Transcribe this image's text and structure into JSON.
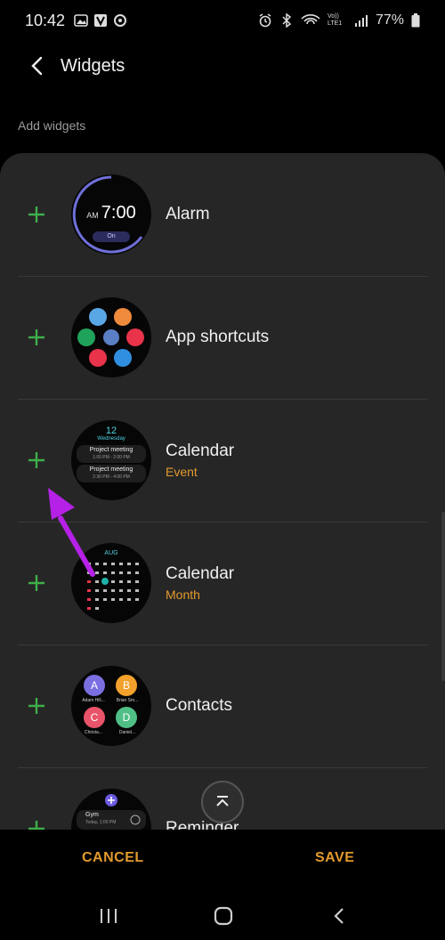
{
  "status_bar": {
    "time": "10:42",
    "battery": "77%",
    "net": "Vo)) LTE1"
  },
  "header": {
    "title": "Widgets"
  },
  "section": {
    "label": "Add widgets"
  },
  "widgets": [
    {
      "title": "Alarm",
      "sub": "",
      "ampm": "AM",
      "clock": "7:00",
      "state": "On"
    },
    {
      "title": "App shortcuts",
      "sub": ""
    },
    {
      "title": "Calendar",
      "sub": "Event",
      "day": "12",
      "weekday": "Wednesday",
      "event1": "Project meeting",
      "time1": "1:00 PM - 2:00 PM",
      "event2": "Project meeting",
      "time2": "2:30 PM - 4:00 PM"
    },
    {
      "title": "Calendar",
      "sub": "Month",
      "month": "AUG"
    },
    {
      "title": "Contacts",
      "sub": "",
      "c1": "A",
      "n1": "Adam Hill...",
      "c2": "B",
      "n2": "Brian Sm...",
      "c3": "C",
      "n3": "Christa...",
      "c4": "D",
      "n4": "Daniel..."
    },
    {
      "title": "Reminder",
      "sub": "",
      "item": "Gym",
      "item_time": "Today, 1:00 PM"
    }
  ],
  "actions": {
    "cancel": "CANCEL",
    "save": "SAVE"
  },
  "colors": {
    "accent": "#e39a2d",
    "plus": "#3fae49",
    "annotation": "#b521e6",
    "card": "#262626"
  },
  "icons": [
    "back-arrow-icon",
    "plus-icon",
    "scroll-top-icon",
    "recents-icon",
    "home-icon",
    "back-icon"
  ]
}
